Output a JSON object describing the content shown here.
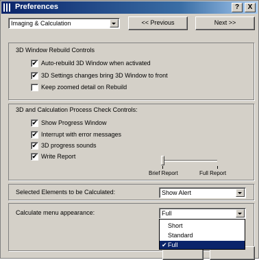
{
  "window": {
    "title": "Preferences",
    "help_label": "?",
    "close_label": "X"
  },
  "header": {
    "category_value": "Imaging & Calculation",
    "previous_label": "<< Previous",
    "next_label": "Next >>"
  },
  "rebuild_group": {
    "label": "3D Window Rebuild Controls",
    "items": [
      {
        "label": "Auto-rebuild 3D Window when activated",
        "checked": true,
        "mark": "✔"
      },
      {
        "label": "3D Settings changes bring 3D Window to front",
        "checked": true,
        "mark": "✔"
      },
      {
        "label": "Keep zoomed detail on Rebuild",
        "checked": false,
        "mark": ""
      }
    ]
  },
  "process_group": {
    "label": "3D and Calculation Process Check Controls:",
    "items": [
      {
        "label": "Show Progress Window",
        "checked": true,
        "mark": "✔"
      },
      {
        "label": "Interrupt with error messages",
        "checked": true,
        "mark": "✔"
      },
      {
        "label": "3D progress sounds",
        "checked": true,
        "mark": "✔"
      },
      {
        "label": "Write Report",
        "checked": true,
        "mark": "✔"
      }
    ],
    "slider": {
      "min_label": "Brief Report",
      "max_label": "Full Report",
      "value": 0
    }
  },
  "selected_elements": {
    "label": "Selected Elements to be Calculated:",
    "value": "Show Alert"
  },
  "calculate_menu": {
    "label": "Calculate menu appearance:",
    "value": "Full",
    "options": [
      {
        "label": "Short",
        "selected": false,
        "mark": ""
      },
      {
        "label": "Standard",
        "selected": false,
        "mark": ""
      },
      {
        "label": "Full",
        "selected": true,
        "mark": "✔"
      }
    ]
  },
  "colors": {
    "dialog_face": "#d4d0c8",
    "title_gradient_start": "#0a246a",
    "selection": "#0a246a"
  }
}
